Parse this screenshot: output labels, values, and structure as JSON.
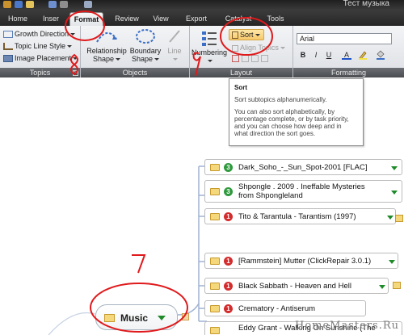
{
  "window": {
    "title": "Тест музыка"
  },
  "tabs": [
    {
      "label": "Home"
    },
    {
      "label": "Inser"
    },
    {
      "label": "Format"
    },
    {
      "label": "Review"
    },
    {
      "label": "View"
    },
    {
      "label": "Export"
    },
    {
      "label": "Catalyst"
    },
    {
      "label": "Tools"
    }
  ],
  "ribbon": {
    "topics": {
      "group_label": "Topics",
      "growth_direction": "Growth Direction",
      "topic_line_style": "Topic Line Style",
      "image_placement": "Image Placement"
    },
    "objects": {
      "group_label": "Objects",
      "relationship_shape": "Relationship\nShape",
      "relationship_line1": "Relationship",
      "relationship_line2": "Shape",
      "boundary_line1": "Boundary",
      "boundary_line2": "Shape",
      "line_label": "Line"
    },
    "layout": {
      "group_label": "Layout",
      "numbering": "Numbering",
      "sort": "Sort",
      "align_topics": "Align Topics"
    },
    "formatting": {
      "group_label": "Formatting",
      "font_name": "Arial",
      "bold": "B",
      "italic": "I",
      "underline": "U",
      "font_color": "A"
    }
  },
  "tooltip": {
    "title": "Sort",
    "line1": "Sort subtopics alphanumerically.",
    "line2": "You can also sort alphabetically, by",
    "line3": "percentage complete, or by task priority,",
    "line4": "and you can choose how deep and in",
    "line5": "what direction the sort goes."
  },
  "map": {
    "central_topic": "Music",
    "topics": [
      {
        "num": "3",
        "color": "green",
        "label_line1": "Dark_Soho_-_Sun_Spot-2001 [FLAC]",
        "label_line2": ""
      },
      {
        "num": "3",
        "color": "green",
        "label_line1": "Shpongle . 2009 . Ineffable Mysteries",
        "label_line2": "from Shpongleland"
      },
      {
        "num": "1",
        "color": "red",
        "label_line1": "Tito & Tarantula - Tarantism (1997)",
        "label_line2": ""
      },
      {
        "num": "1",
        "color": "red",
        "label_line1": "[Rammstein] Mutter (ClickRepair 3.0.1)",
        "label_line2": ""
      },
      {
        "num": "1",
        "color": "red",
        "label_line1": "Black Sabbath - Heaven and Hell",
        "label_line2": ""
      },
      {
        "num": "1",
        "color": "red",
        "label_line1": "Crematory - Antiserum",
        "label_line2": ""
      },
      {
        "num": "",
        "color": "",
        "label_line1": "Eddy Grant - Walking On Sunshine (The",
        "label_line2": ""
      }
    ]
  },
  "annotations": {
    "n7": "7",
    "n8": "8",
    "n9": "9"
  },
  "watermark": "HomeMasters.Ru",
  "colors": {
    "annotation_red": "#e0191b",
    "ribbon_dark": "#2b2b2b",
    "accent_green": "#2f9a3d",
    "priority_red": "#d42c2c"
  }
}
